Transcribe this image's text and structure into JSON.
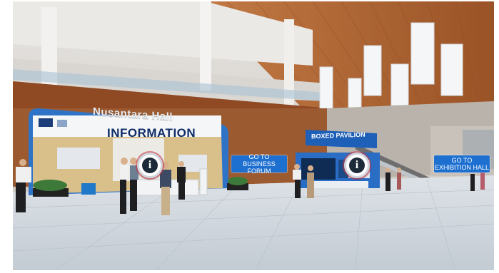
{
  "scene": {
    "hall_name": "Nusantara Hall",
    "info_booth_title": "INFORMATION",
    "pavilion_title": "BOXED PAVILION"
  },
  "navigation": {
    "business_forum": {
      "line1": "GO TO",
      "line2": "BUSINESS FORUM"
    },
    "exhibition_hall": {
      "line1": "GO TO",
      "line2": "EXHIBITION HALL"
    }
  },
  "hotspots": {
    "info_booth": {
      "icon": "info-icon",
      "glyph": "i"
    },
    "pavilion": {
      "icon": "info-icon",
      "glyph": "i"
    }
  },
  "colors": {
    "nav_button": "#1d6fd0",
    "booth_frame": "#2f73c7",
    "ceiling_wood": "#b46a38",
    "floor": "#cfd6dd"
  }
}
